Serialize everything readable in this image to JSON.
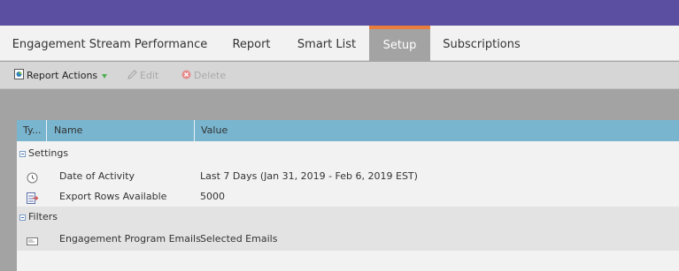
{
  "tabs": [
    {
      "label": "Engagement Stream Performance"
    },
    {
      "label": "Report"
    },
    {
      "label": "Smart List"
    },
    {
      "label": "Setup",
      "active": true
    },
    {
      "label": "Subscriptions"
    }
  ],
  "toolbar": {
    "report_actions": "Report Actions",
    "edit": "Edit",
    "delete": "Delete"
  },
  "grid": {
    "columns": [
      "Ty...",
      "Name",
      "Value"
    ],
    "groups": [
      {
        "label": "Settings",
        "rows": [
          {
            "icon": "clock-icon",
            "name": "Date of Activity",
            "value": "Last 7 Days (Jan 31, 2019 - Feb 6, 2019 EST)"
          },
          {
            "icon": "export-rows-icon",
            "name": "Export Rows Available",
            "value": "5000"
          }
        ]
      },
      {
        "label": "Filters",
        "rows": [
          {
            "icon": "email-icon",
            "name": "Engagement Program Emails",
            "value": "Selected Emails"
          }
        ]
      }
    ]
  },
  "colors": {
    "top_bar": "#5a4fa1",
    "active_tab_accent": "#e97e3c",
    "grid_header": "#79b5cf"
  }
}
